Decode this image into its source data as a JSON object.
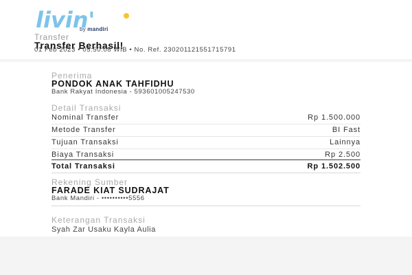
{
  "brand": {
    "logo_text": "livin'",
    "by_label": "by",
    "bank_label": "mandiri",
    "colors": {
      "logo_blue": "#7cc4ea",
      "logo_yellow": "#f7c52b",
      "navy": "#2b3a67"
    }
  },
  "header": {
    "label": "Transfer",
    "title": "Transfer Berhasil!",
    "meta": "01 Feb 2023 • 05:50:08 WIB • No. Ref. 230201121551715791"
  },
  "recipient": {
    "section_label": "Penerima",
    "name": "PONDOK ANAK TAHFIDHU",
    "detail": "Bank Rakyat Indonesia - 593601005247530"
  },
  "transaction": {
    "section_label": "Detail Transaksi",
    "rows": [
      {
        "label": "Nominal Transfer",
        "value": "Rp 1.500.000"
      },
      {
        "label": "Metode Transfer",
        "value": "BI Fast"
      },
      {
        "label": "Tujuan Transaksi",
        "value": "Lainnya"
      },
      {
        "label": "Biaya Transaksi",
        "value": "Rp 2.500"
      }
    ],
    "total": {
      "label": "Total Transaksi",
      "value": "Rp 1.502.500"
    }
  },
  "source": {
    "section_label": "Rekening Sumber",
    "name": "FARADE KIAT SUDRAJAT",
    "detail": "Bank Mandiri - ••••••••••5556"
  },
  "notes": {
    "section_label": "Keterangan Transaksi",
    "text": "Syah Zar Usaku Kayla Aulia"
  }
}
